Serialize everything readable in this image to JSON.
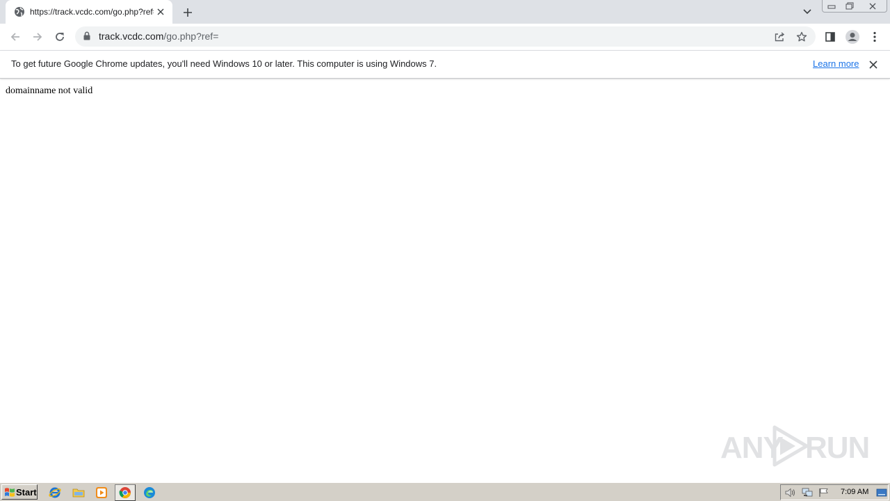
{
  "browser": {
    "tab": {
      "title": "https://track.vcdc.com/go.php?ref=",
      "favicon": "globe-icon"
    },
    "toolbar": {
      "url_host": "track.vcdc.com",
      "url_path": "/go.php?ref=",
      "icons": [
        "back-arrow-icon",
        "forward-arrow-icon",
        "reload-icon",
        "lock-icon",
        "share-icon",
        "bookmark-star-icon",
        "side-panel-icon",
        "profile-avatar-icon",
        "kebab-menu-icon"
      ]
    },
    "infobar": {
      "message": "To get future Google Chrome updates, you'll need Windows 10 or later. This computer is using Windows 7.",
      "link_label": "Learn more"
    }
  },
  "page": {
    "body_text": "domainname not valid"
  },
  "watermark": {
    "left": "ANY",
    "right": "RUN"
  },
  "taskbar": {
    "start_label": "Start",
    "apps": [
      "internet-explorer-icon",
      "file-explorer-icon",
      "media-player-icon",
      "chrome-icon",
      "edge-icon"
    ],
    "clock": "7:09 AM"
  },
  "colors": {
    "tabstrip": "#dee1e6",
    "omnibox": "#f1f3f4",
    "link": "#1a73e8",
    "taskbar": "#d4d0c8"
  }
}
